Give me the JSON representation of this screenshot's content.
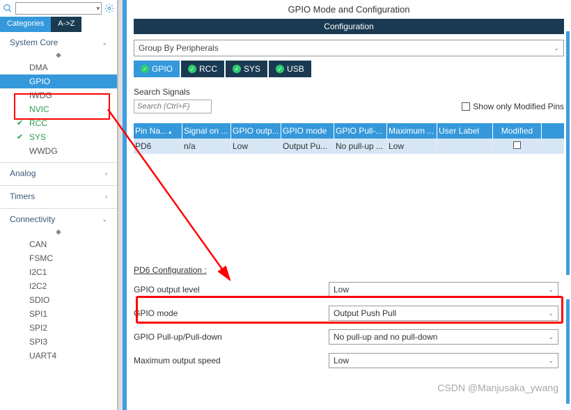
{
  "header": {
    "title": "GPIO Mode and Configuration",
    "config_label": "Configuration"
  },
  "left_tabs": {
    "categories": "Categories",
    "az": "A->Z"
  },
  "categories": {
    "system_core": {
      "label": "System Core",
      "items": [
        {
          "label": "DMA",
          "state": "normal"
        },
        {
          "label": "GPIO",
          "state": "selected"
        },
        {
          "label": "IWDG",
          "state": "normal"
        },
        {
          "label": "NVIC",
          "state": "green"
        },
        {
          "label": "RCC",
          "state": "green_check"
        },
        {
          "label": "SYS",
          "state": "green_check"
        },
        {
          "label": "WWDG",
          "state": "normal"
        }
      ]
    },
    "analog": {
      "label": "Analog"
    },
    "timers": {
      "label": "Timers"
    },
    "connectivity": {
      "label": "Connectivity",
      "items": [
        {
          "label": "CAN"
        },
        {
          "label": "FSMC"
        },
        {
          "label": "I2C1"
        },
        {
          "label": "I2C2"
        },
        {
          "label": "SDIO"
        },
        {
          "label": "SPI1"
        },
        {
          "label": "SPI2"
        },
        {
          "label": "SPI3"
        },
        {
          "label": "UART4"
        }
      ]
    }
  },
  "group_by": {
    "value": "Group By Peripherals"
  },
  "periph_tabs": [
    {
      "label": "GPIO",
      "active": true
    },
    {
      "label": "RCC",
      "active": false
    },
    {
      "label": "SYS",
      "active": false
    },
    {
      "label": "USB",
      "active": false
    }
  ],
  "search": {
    "label": "Search Signals",
    "placeholder": "Search (Ctrl+F)",
    "show_modified": "Show only Modified Pins"
  },
  "table": {
    "headers": [
      "Pin Na...",
      "Signal on ...",
      "GPIO outp...",
      "GPIO mode",
      "GPIO Pull-...",
      "Maximum ...",
      "User Label",
      "Modified"
    ],
    "row": {
      "pin": "PD6",
      "signal": "n/a",
      "output": "Low",
      "mode": "Output Pu...",
      "pull": "No pull-up ...",
      "max": "Low",
      "userlabel": ""
    }
  },
  "pin_config": {
    "title": "PD6 Configuration :",
    "rows": [
      {
        "label": "GPIO output level",
        "value": "Low"
      },
      {
        "label": "GPIO mode",
        "value": "Output Push Pull"
      },
      {
        "label": "GPIO Pull-up/Pull-down",
        "value": "No pull-up and no pull-down"
      },
      {
        "label": "Maximum output speed",
        "value": "Low"
      }
    ]
  },
  "watermark": "CSDN @Manjusaka_ywang"
}
